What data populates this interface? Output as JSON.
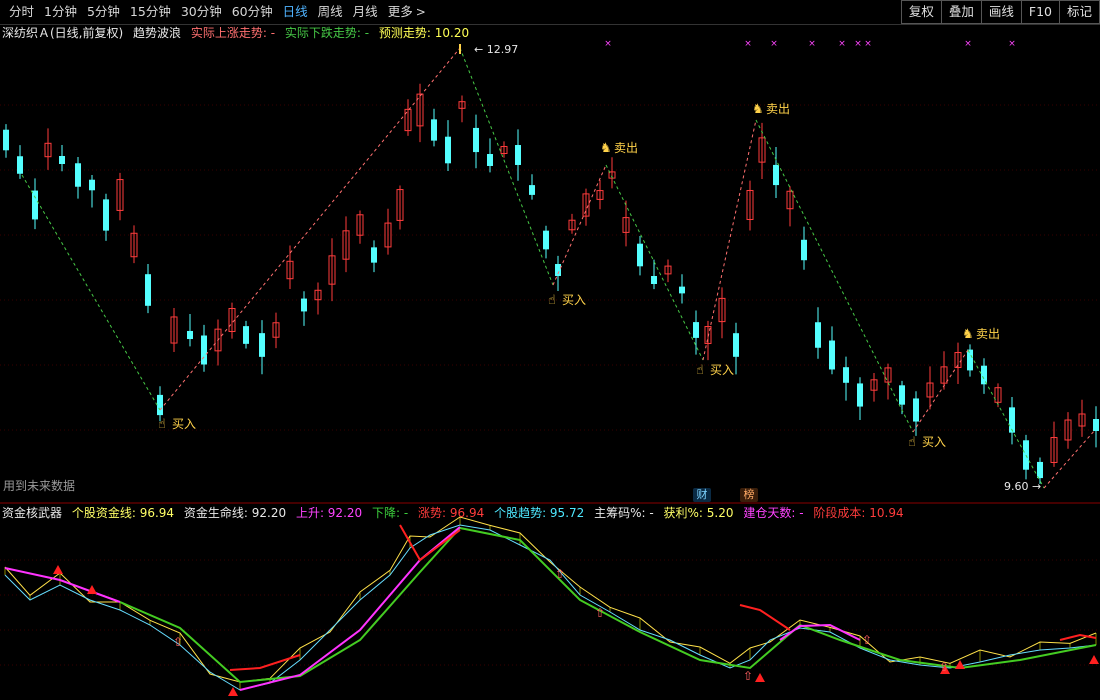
{
  "toolbar": {
    "periods": [
      "分时",
      "1分钟",
      "5分钟",
      "15分钟",
      "30分钟",
      "60分钟",
      "日线",
      "周线",
      "月线",
      "更多"
    ],
    "active_period": "日线",
    "more_chevron": ">",
    "right_buttons": [
      "复权",
      "叠加",
      "画线",
      "F10",
      "标记"
    ]
  },
  "main_header": {
    "stock": "深纺织Ａ(日线,前复权)",
    "indicator": "趋势波浪",
    "rise_label": "实际上涨走势: -",
    "fall_label": "实际下跌走势: -",
    "pred_label": "预测走势: 10.20"
  },
  "annotations": {
    "high_price": "12.97",
    "low_price": "9.60",
    "buy": "买入",
    "sell": "卖出",
    "future_note": "用到未来数据",
    "badge_cai": "财",
    "badge_bang": "榜"
  },
  "sub_header": {
    "name": "资金核武器",
    "items": [
      {
        "label": "个股资金线: 96.94",
        "color": "#ffff66"
      },
      {
        "label": "资金生命线: 92.20",
        "color": "#e8e8e8"
      },
      {
        "label": "上升: 92.20",
        "color": "#ff44ff"
      },
      {
        "label": "下降: -",
        "color": "#3ccf3c"
      },
      {
        "label": "涨势: 96.94",
        "color": "#ff3c3c"
      },
      {
        "label": "个股趋势: 95.72",
        "color": "#4ee8ff"
      },
      {
        "label": "主筹码%: -",
        "color": "#e8e8e8"
      },
      {
        "label": "获利%: 5.20",
        "color": "#ffff66"
      },
      {
        "label": "建仓天数: -",
        "color": "#ff44ff"
      },
      {
        "label": "阶段成本: 10.94",
        "color": "#ff3c3c"
      }
    ]
  },
  "colors": {
    "up_candle": "#ff3c3c",
    "down_candle": "#54ffff",
    "rise_trend_line": "#ff7070",
    "fall_trend_line": "#46c846",
    "capital_line_up": "#ff2020",
    "life_line_up": "#ff33ff",
    "life_line_down": "#44cc22",
    "trend_line": "#66ddff",
    "signal_marker": "#ffd24a"
  }
}
